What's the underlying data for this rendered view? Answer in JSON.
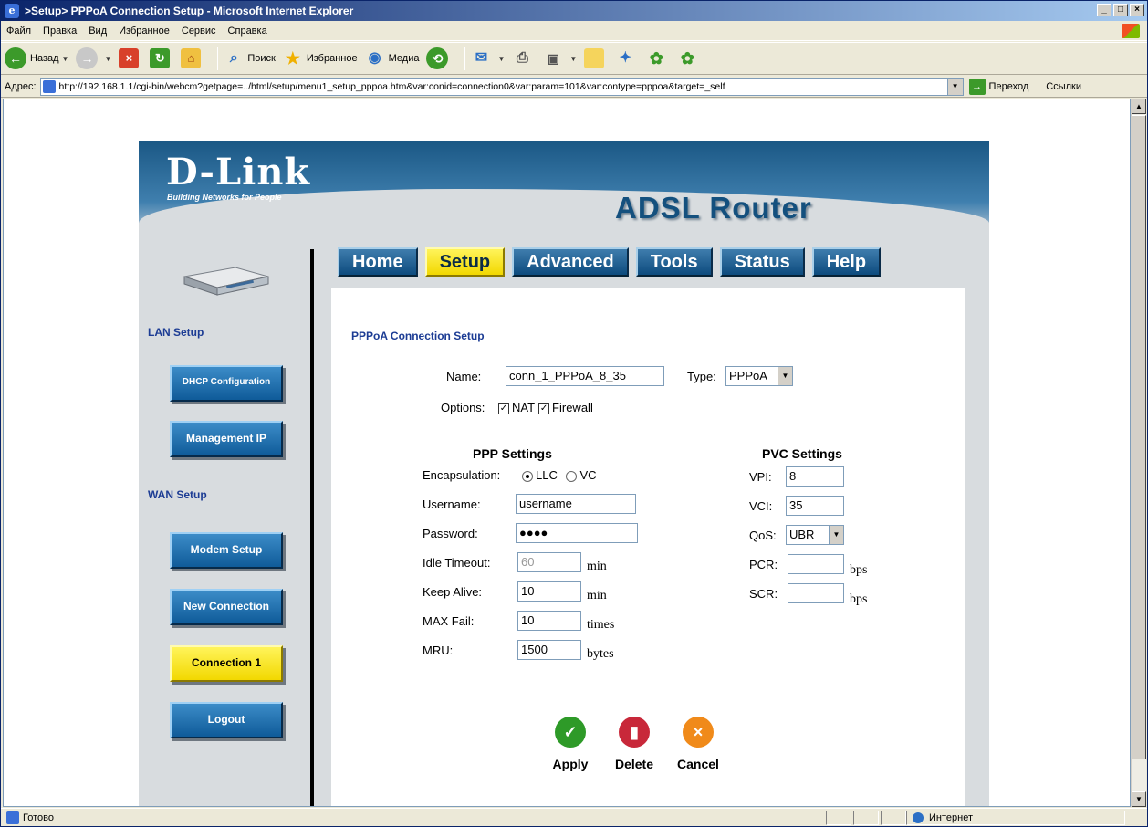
{
  "window": {
    "title": ">Setup> PPPoA Connection Setup - Microsoft Internet Explorer"
  },
  "menu": [
    "Файл",
    "Правка",
    "Вид",
    "Избранное",
    "Сервис",
    "Справка"
  ],
  "toolbar": {
    "back": "Назад",
    "search": "Поиск",
    "favorites": "Избранное",
    "media": "Медиа"
  },
  "address": {
    "label": "Адрес:",
    "url": "http://192.168.1.1/cgi-bin/webcm?getpage=../html/setup/menu1_setup_pppoa.htm&var:conid=connection0&var:param=101&var:contype=pppoa&target=_self",
    "go": "Переход",
    "links": "Ссылки"
  },
  "status": {
    "text": "Готово",
    "zone": "Интернет"
  },
  "dlink": {
    "logo": "D-Link",
    "tagline": "Building Networks for People",
    "title": "ADSL Router",
    "tabs": [
      "Home",
      "Setup",
      "Advanced",
      "Tools",
      "Status",
      "Help"
    ],
    "active_tab": "Setup",
    "sidebar": {
      "lan_label": "LAN Setup",
      "wan_label": "WAN Setup",
      "buttons": [
        "DHCP Configuration",
        "Management IP",
        "Modem Setup",
        "New Connection",
        "Connection 1",
        "Logout"
      ],
      "active": "Connection 1"
    },
    "form": {
      "section_title": "PPPoA Connection Setup",
      "name_label": "Name:",
      "name_value": "conn_1_PPPoA_8_35",
      "type_label": "Type:",
      "type_value": "PPPoA",
      "options_label": "Options:",
      "nat_label": "NAT",
      "firewall_label": "Firewall",
      "ppp_heading": "PPP Settings",
      "pvc_heading": "PVC Settings",
      "encap_label": "Encapsulation:",
      "encap_llc": "LLC",
      "encap_vc": "VC",
      "username_label": "Username:",
      "username_value": "username",
      "password_label": "Password:",
      "password_value": "●●●●",
      "idle_label": "Idle Timeout:",
      "idle_value": "60",
      "idle_unit": "min",
      "keepalive_label": "Keep Alive:",
      "keepalive_value": "10",
      "keepalive_unit": "min",
      "maxfail_label": "MAX Fail:",
      "maxfail_value": "10",
      "maxfail_unit": "times",
      "mru_label": "MRU:",
      "mru_value": "1500",
      "mru_unit": "bytes",
      "vpi_label": "VPI:",
      "vpi_value": "8",
      "vci_label": "VCI:",
      "vci_value": "35",
      "qos_label": "QoS:",
      "qos_value": "UBR",
      "pcr_label": "PCR:",
      "pcr_unit": "bps",
      "scr_label": "SCR:",
      "scr_unit": "bps",
      "apply": "Apply",
      "delete": "Delete",
      "cancel": "Cancel"
    }
  }
}
